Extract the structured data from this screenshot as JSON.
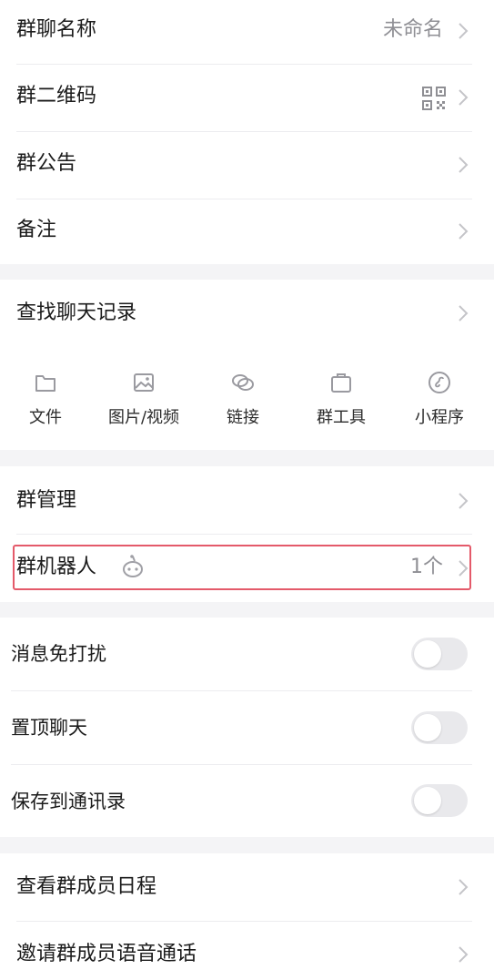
{
  "group_info": {
    "name_label": "群聊名称",
    "name_value": "未命名",
    "qrcode_label": "群二维码",
    "notice_label": "群公告",
    "remark_label": "备注"
  },
  "history": {
    "search_label": "查找聊天记录",
    "tools": [
      {
        "label": "文件",
        "icon": "folder-icon"
      },
      {
        "label": "图片/视频",
        "icon": "image-icon"
      },
      {
        "label": "链接",
        "icon": "link-icon"
      },
      {
        "label": "群工具",
        "icon": "briefcase-icon"
      },
      {
        "label": "小程序",
        "icon": "mini-program-icon"
      }
    ]
  },
  "manage": {
    "manage_label": "群管理",
    "robot_label": "群机器人",
    "robot_count": "1个"
  },
  "switches": [
    {
      "label": "消息免打扰",
      "on": false
    },
    {
      "label": "置顶聊天",
      "on": false
    },
    {
      "label": "保存到通讯录",
      "on": false
    }
  ],
  "more": {
    "schedule_label": "查看群成员日程",
    "voice_call_label": "邀请群成员语音通话"
  },
  "colors": {
    "highlight_border": "#e45a6a",
    "toggle_off": "#e9e9ec",
    "secondary_text": "#8f8f94"
  }
}
